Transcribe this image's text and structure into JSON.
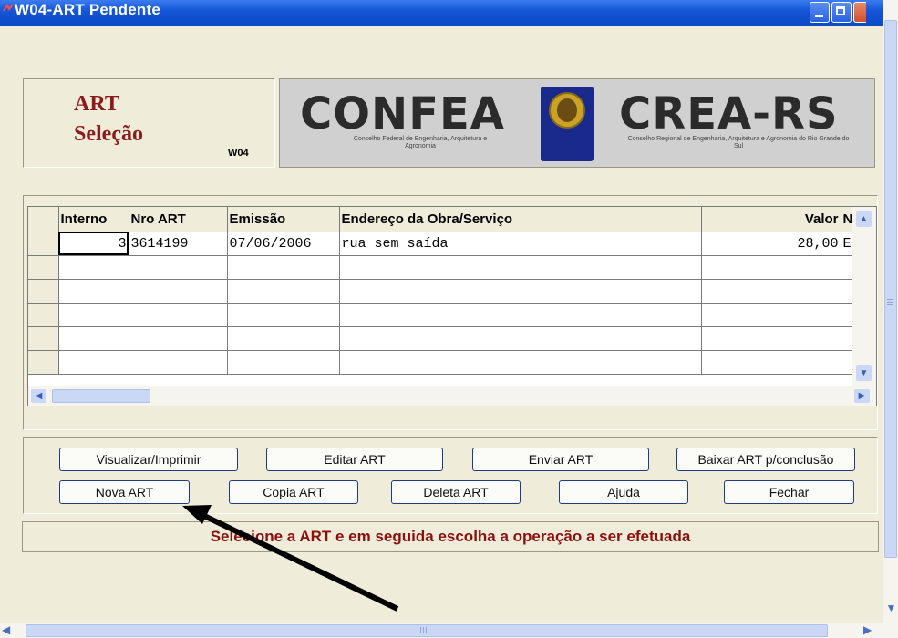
{
  "window": {
    "title": "W04-ART Pendente"
  },
  "header": {
    "line1": "ART",
    "line2": "Seleção",
    "code": "W04"
  },
  "logo": {
    "left_text": "CONFEA",
    "left_sub": "Conselho Federal de Engenharia, Arquitetura e Agronomia",
    "right_text": "CREA-RS",
    "right_sub": "Conselho Regional de Engenharia, Arquitetura e Agronomia do Rio Grande do Sul"
  },
  "grid": {
    "columns": [
      "Interno",
      "Nro ART",
      "Emissão",
      "Endereço da Obra/Serviço",
      "Valor",
      "N"
    ],
    "rows": [
      {
        "interno": "3",
        "nro_art": "3614199",
        "emissao": "07/06/2006",
        "endereco": "rua sem saída",
        "valor": "28,00",
        "n": "E"
      }
    ]
  },
  "buttons": {
    "visualizar": "Visualizar/Imprimir",
    "editar": "Editar ART",
    "enviar": "Enviar ART",
    "baixar": "Baixar ART p/conclusão",
    "nova": "Nova ART",
    "copia": "Copia ART",
    "deleta": "Deleta ART",
    "ajuda": "Ajuda",
    "fechar": "Fechar"
  },
  "status": {
    "message": "Selecione a ART e em seguida escolha a operação a ser efetuada"
  },
  "colors": {
    "title_bar": "#0b49c6",
    "client_bg": "#f0ecda",
    "heading_red": "#8b1c1c",
    "status_red": "#8b1010"
  },
  "icons": [
    "app-icon",
    "minimize-icon",
    "maximize-icon",
    "close-icon",
    "scroll-arrow-icons",
    "annotation-arrow"
  ]
}
